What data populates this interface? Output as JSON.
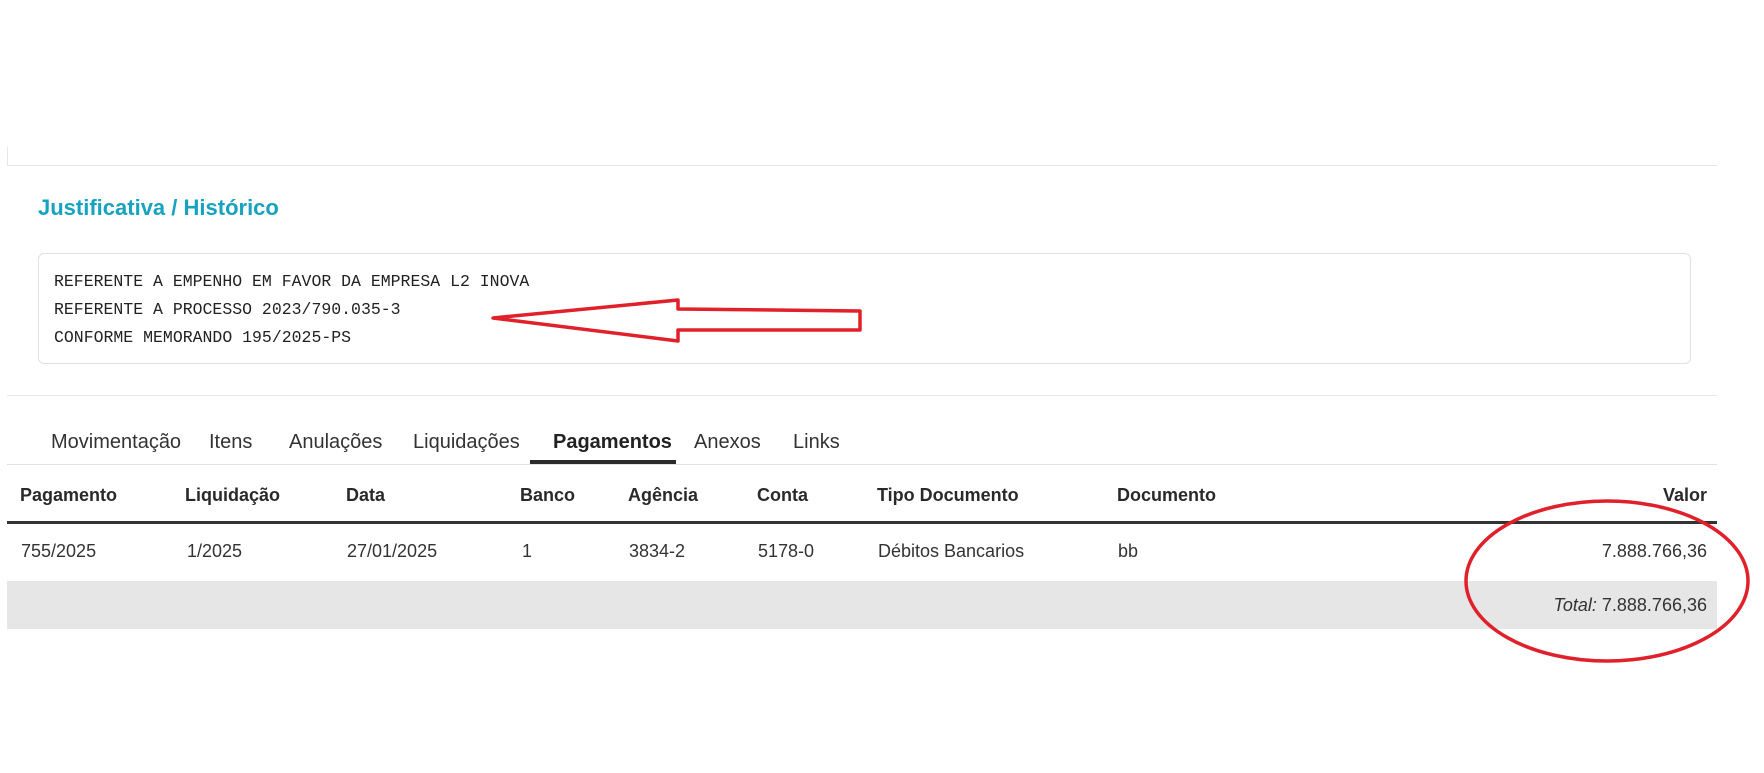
{
  "section": {
    "title": "Justificativa / Histórico",
    "lines": [
      "REFERENTE A EMPENHO EM FAVOR DA EMPRESA L2 INOVA",
      "REFERENTE A PROCESSO 2023/790.035-3",
      "CONFORME MEMORANDO 195/2025-PS"
    ]
  },
  "tabs": [
    {
      "label": "Movimentação"
    },
    {
      "label": "Itens"
    },
    {
      "label": "Anulações"
    },
    {
      "label": "Liquidações"
    },
    {
      "label": "Pagamentos",
      "active": true
    },
    {
      "label": "Anexos"
    },
    {
      "label": "Links"
    }
  ],
  "table": {
    "columns": [
      "Pagamento",
      "Liquidação",
      "Data",
      "Banco",
      "Agência",
      "Conta",
      "Tipo Documento",
      "Documento",
      "Valor"
    ],
    "rows": [
      [
        "755/2025",
        "1/2025",
        "27/01/2025",
        "1",
        "3834-2",
        "5178-0",
        "Débitos Bancarios",
        "bb",
        "7.888.766,36"
      ]
    ],
    "total_label": "Total:",
    "total_value": "7.888.766,36"
  },
  "colors": {
    "accent": "#17a2c0",
    "annotation": "#e0202a",
    "total_row_bg": "#e6e6e6"
  }
}
